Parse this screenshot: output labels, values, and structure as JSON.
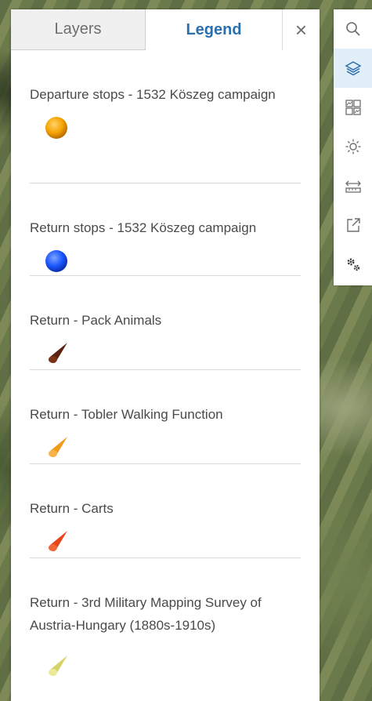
{
  "tabs": {
    "layers_label": "Layers",
    "legend_label": "Legend",
    "close_label": "×"
  },
  "legend": {
    "items": [
      {
        "title": "Departure stops - 1532 Köszeg campaign",
        "symbol": "sphere",
        "color": "#f5a300"
      },
      {
        "title": "Return stops - 1532 Köszeg campaign",
        "symbol": "sphere",
        "color": "#1a55ff"
      },
      {
        "title": "Return - Pack Animals",
        "symbol": "cone",
        "color": "#5a2210"
      },
      {
        "title": "Return - Tobler Walking Function",
        "symbol": "cone",
        "color": "#f29a1a"
      },
      {
        "title": "Return - Carts",
        "symbol": "cone",
        "color": "#e8451a"
      },
      {
        "title": "Return - 3rd Military Mapping Survey of Austria-Hungary (1880s-1910s)",
        "symbol": "cone",
        "color": "#e2e07a"
      }
    ]
  },
  "toolbar": {
    "tools": [
      {
        "icon": "search-icon",
        "active": false
      },
      {
        "icon": "layers-icon",
        "active": true
      },
      {
        "icon": "basemap-gallery-icon",
        "active": false
      },
      {
        "icon": "daylight-icon",
        "active": false
      },
      {
        "icon": "measure-icon",
        "active": false
      },
      {
        "icon": "share-icon",
        "active": false
      },
      {
        "icon": "settings-icon",
        "active": false
      }
    ]
  },
  "colors": {
    "accent": "#2a6fae",
    "active_tool_bg": "#e2eef8",
    "icon": "#6e6e6e"
  }
}
